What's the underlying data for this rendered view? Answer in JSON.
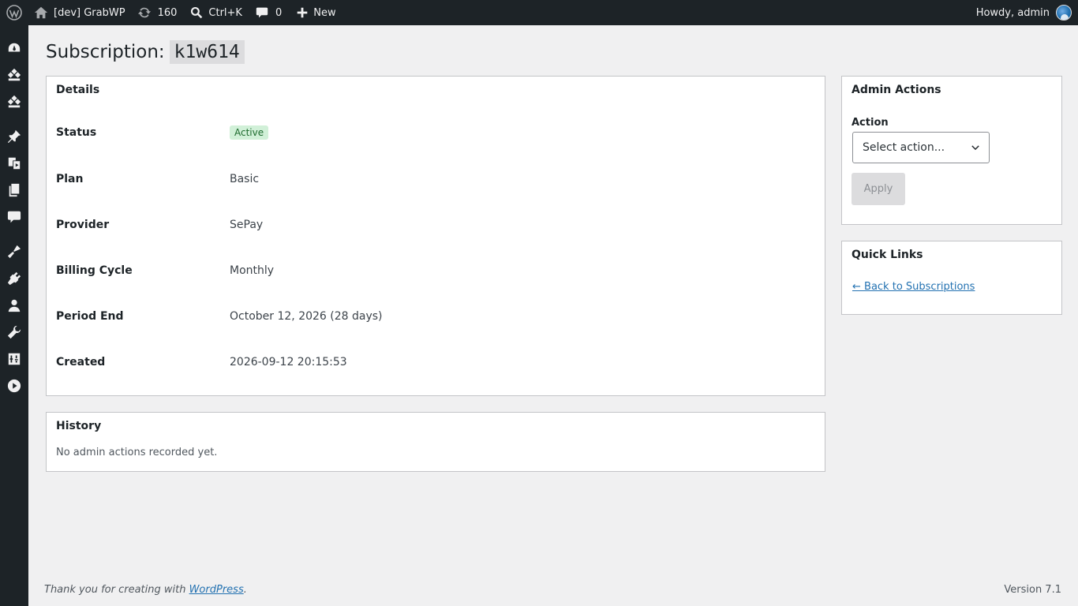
{
  "adminbar": {
    "site_name": "[dev] GrabWP",
    "updates_count": "160",
    "search_shortcut": "Ctrl+K",
    "comments_count": "0",
    "new_label": "New",
    "howdy": "Howdy, admin"
  },
  "sidebar": {
    "icons": [
      "dashboard-icon",
      "store-icon",
      "store-alt-icon",
      "posts-icon",
      "media-icon",
      "pages-icon",
      "comments-icon",
      "appearance-icon",
      "plugins-icon",
      "users-icon",
      "tools-icon",
      "settings-icon",
      "play-icon"
    ]
  },
  "page": {
    "title_prefix": "Subscription:",
    "subscription_id": "k1w614"
  },
  "details": {
    "heading": "Details",
    "rows": [
      {
        "label": "Status",
        "value": "Active"
      },
      {
        "label": "Plan",
        "value": "Basic"
      },
      {
        "label": "Provider",
        "value": "SePay"
      },
      {
        "label": "Billing Cycle",
        "value": "Monthly"
      },
      {
        "label": "Period End",
        "value": "October 12, 2026 (28 days)"
      },
      {
        "label": "Created",
        "value": "2026-09-12 20:15:53"
      }
    ]
  },
  "history": {
    "heading": "History",
    "empty_text": "No admin actions recorded yet."
  },
  "admin_actions": {
    "heading": "Admin Actions",
    "action_label": "Action",
    "select_value": "Select action...",
    "apply_label": "Apply"
  },
  "quick_links": {
    "heading": "Quick Links",
    "back_link": "← Back to Subscriptions"
  },
  "footer": {
    "thanks_text": "Thank you for creating with ",
    "wordpress_link": "WordPress",
    "period": ".",
    "version": "Version 7.1"
  },
  "colors": {
    "adminbar_bg": "#1d2327",
    "page_bg": "#f0f0f1",
    "link": "#2271b1",
    "active_badge_bg": "#d1f0d8",
    "active_badge_text": "#1e6b2f"
  }
}
